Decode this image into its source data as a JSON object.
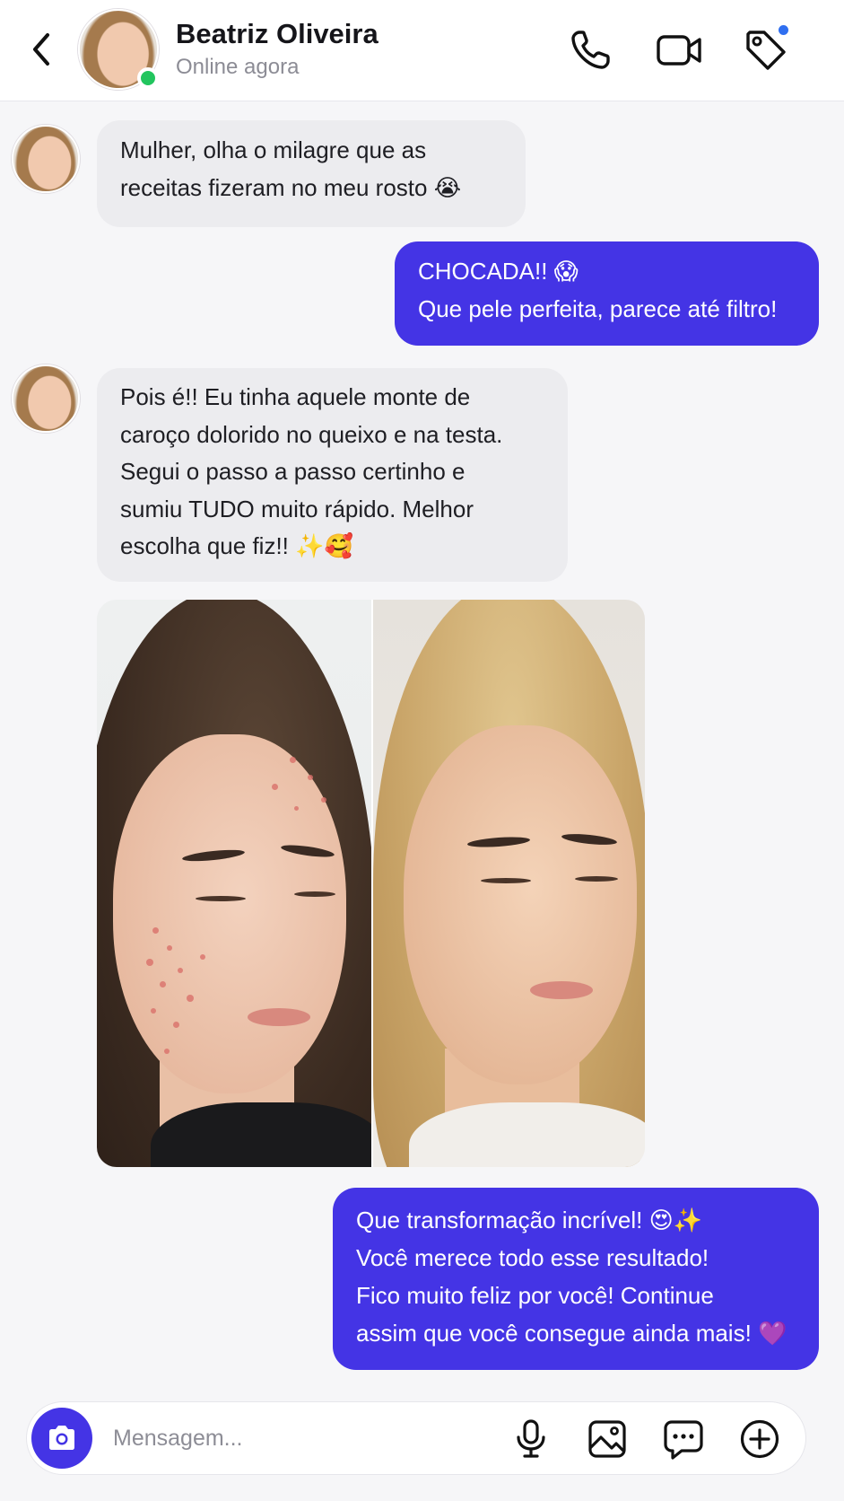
{
  "header": {
    "contact_name": "Beatriz Oliveira",
    "status": "Online agora",
    "icons": [
      "back-icon",
      "phone-icon",
      "video-camera-icon",
      "tag-icon"
    ]
  },
  "messages": [
    {
      "direction": "incoming",
      "lines": [
        "Mulher, olha o milagre que as",
        "receitas fizeram no meu rosto 😭"
      ]
    },
    {
      "direction": "outgoing",
      "lines": [
        "CHOCADA!! 😱",
        "Que pele perfeita, parece até filtro!"
      ]
    },
    {
      "direction": "incoming",
      "lines": [
        "Pois é!!  Eu tinha aquele monte de",
        "caroço dolorido no queixo e na testa.",
        "Segui o passo a passo certinho e",
        "sumiu TUDO muito rápido. Melhor",
        "escolha que fiz!! ✨🥰"
      ]
    },
    {
      "direction": "outgoing",
      "lines": [
        "Que transformação incrível! 😍✨",
        "Você merece todo esse resultado!",
        "Fico muito feliz por você! Continue",
        "assim que você consegue ainda mais! 💜"
      ]
    }
  ],
  "photo": {
    "type": "before-after",
    "panels": [
      "before",
      "after"
    ]
  },
  "composer": {
    "placeholder": "Mensagem...",
    "icons": [
      "camera-icon",
      "microphone-icon",
      "image-gallery-icon",
      "chat-bubble-icon",
      "add-circle-icon"
    ]
  },
  "colors": {
    "accent": "#4434e5",
    "online": "#22c55e",
    "notification": "#2f6ff0",
    "incoming_bubble": "#ececef",
    "background": "#f6f6f8"
  }
}
